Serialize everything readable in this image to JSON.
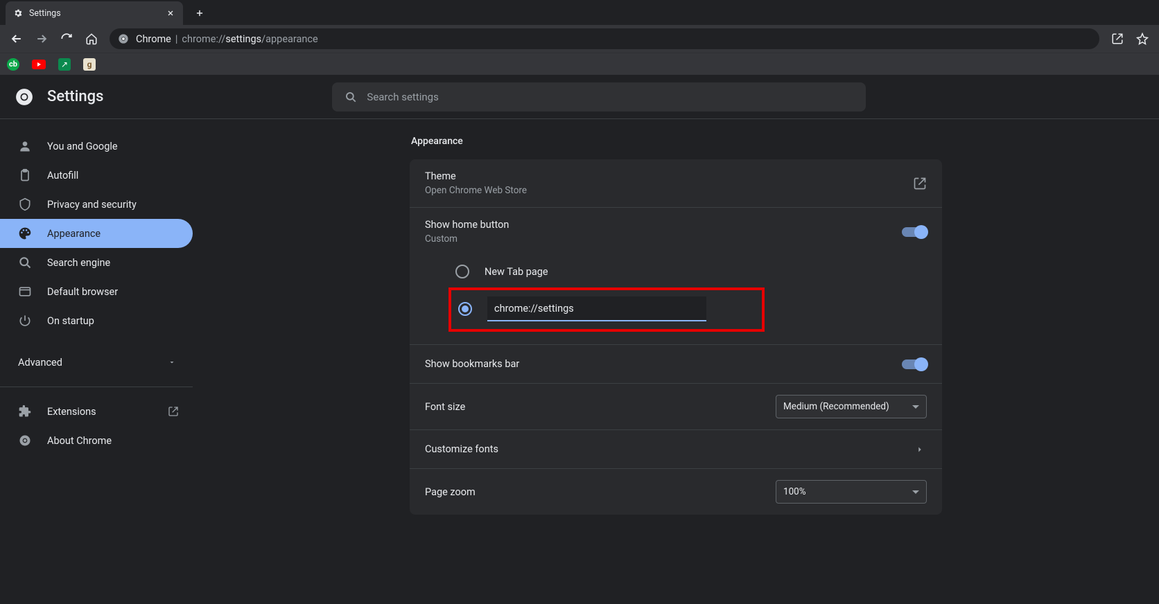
{
  "browser_tab": {
    "title": "Settings"
  },
  "omnibox": {
    "app": "Chrome",
    "url_dim1": "chrome://",
    "url_bold": "settings",
    "url_dim2": "/appearance"
  },
  "header": {
    "title": "Settings",
    "search_placeholder": "Search settings"
  },
  "sidebar": {
    "items": [
      {
        "label": "You and Google"
      },
      {
        "label": "Autofill"
      },
      {
        "label": "Privacy and security"
      },
      {
        "label": "Appearance"
      },
      {
        "label": "Search engine"
      },
      {
        "label": "Default browser"
      },
      {
        "label": "On startup"
      }
    ],
    "advanced": "Advanced",
    "extensions": "Extensions",
    "about": "About Chrome"
  },
  "main": {
    "section_title": "Appearance",
    "theme": {
      "title": "Theme",
      "subtitle": "Open Chrome Web Store"
    },
    "home_button": {
      "title": "Show home button",
      "subtitle": "Custom",
      "option_newtab": "New Tab page",
      "custom_url": "chrome://settings"
    },
    "bookmarks_bar": {
      "title": "Show bookmarks bar"
    },
    "font_size": {
      "title": "Font size",
      "value": "Medium (Recommended)"
    },
    "customize_fonts": {
      "title": "Customize fonts"
    },
    "page_zoom": {
      "title": "Page zoom",
      "value": "100%"
    }
  }
}
